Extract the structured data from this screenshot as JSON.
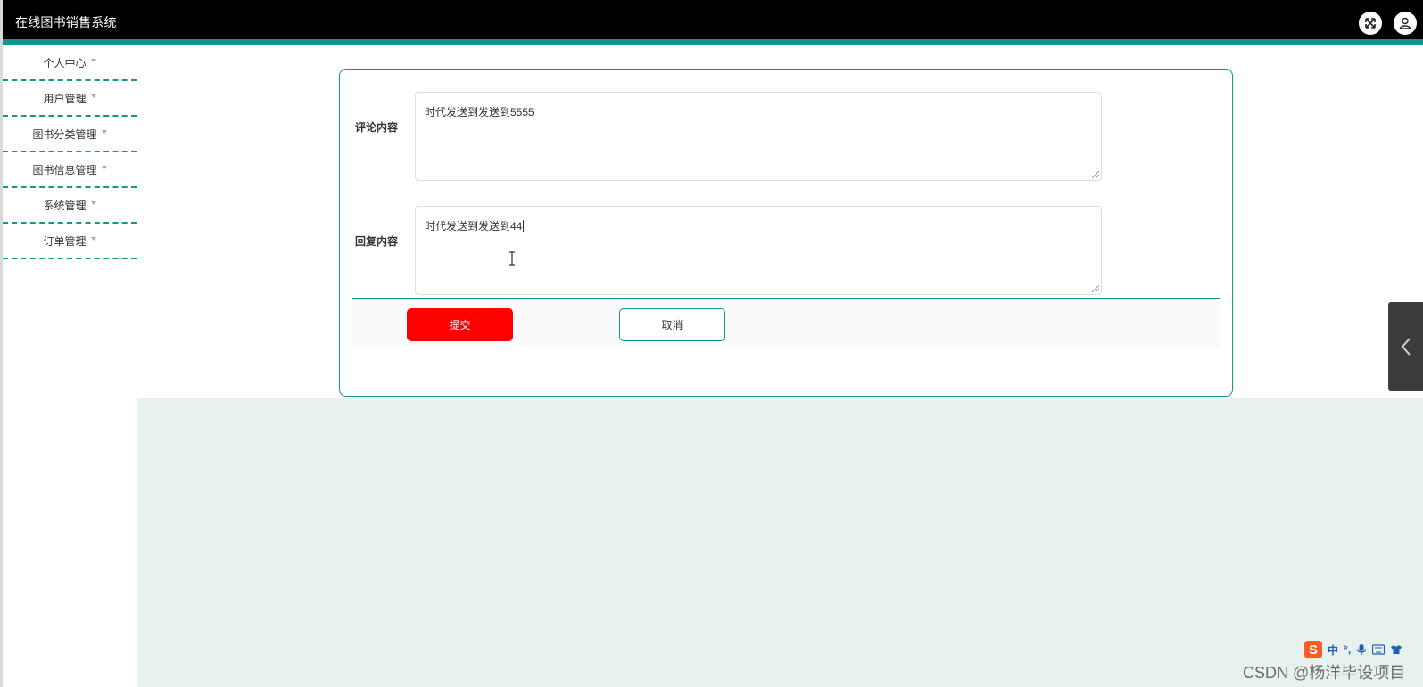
{
  "header": {
    "app_title": "在线图书销售系统",
    "icons": [
      "fullscreen-icon",
      "user-icon"
    ]
  },
  "sidebar": {
    "items": [
      {
        "label": "个人中心"
      },
      {
        "label": "用户管理"
      },
      {
        "label": "图书分类管理"
      },
      {
        "label": "图书信息管理"
      },
      {
        "label": "系统管理"
      },
      {
        "label": "订单管理"
      }
    ]
  },
  "form": {
    "comment": {
      "label": "评论内容",
      "value": "时代发送到发送到5555"
    },
    "reply": {
      "label": "回复内容",
      "value": "时代发送到发送到44"
    },
    "submit_label": "提交",
    "cancel_label": "取消"
  },
  "colors": {
    "accent": "#14978a",
    "submit": "#ff0000",
    "header_bg": "#000000",
    "content_bg": "#e7f1ed"
  },
  "ime_toolbar": {
    "logo": "S",
    "mode": "中",
    "icons": [
      "punctuation-icon",
      "microphone-icon",
      "keyboard-icon",
      "skin-icon"
    ]
  },
  "watermark": "CSDN @杨洋毕设项目"
}
